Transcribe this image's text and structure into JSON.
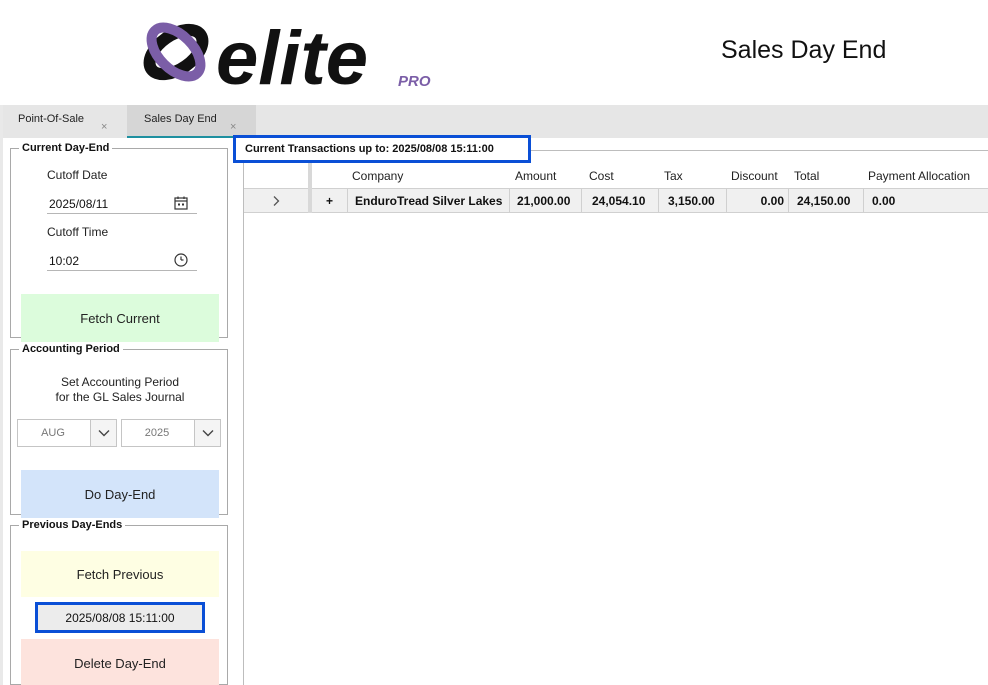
{
  "header": {
    "logo_text": "elite",
    "logo_sub": "PRO",
    "title": "Sales Day End"
  },
  "tabs": [
    {
      "label": "Point-Of-Sale",
      "close": "×",
      "active": false
    },
    {
      "label": "Sales Day End",
      "close": "×",
      "active": true
    }
  ],
  "current_day_end": {
    "legend": "Current Day-End",
    "cutoff_date_label": "Cutoff Date",
    "cutoff_date": "2025/08/11",
    "cutoff_time_label": "Cutoff Time",
    "cutoff_time": "10:02",
    "fetch_button": "Fetch Current",
    "fetch_color": "#dcfcdc"
  },
  "accounting_period": {
    "legend": "Accounting Period",
    "description_line1": "Set Accounting Period",
    "description_line2": "for the GL Sales Journal",
    "month": "AUG",
    "year": "2025",
    "day_end_button": "Do Day-End",
    "day_end_color": "#d3e4fa"
  },
  "previous_day_ends": {
    "legend": "Previous Day-Ends",
    "fetch_button": "Fetch Previous",
    "selected": "2025/08/08 15:11:00",
    "delete_button": "Delete Day-End"
  },
  "transactions": {
    "header": "Current Transactions up to: 2025/08/08 15:11:00",
    "columns": [
      "Company",
      "Amount",
      "Cost",
      "Tax",
      "Discount",
      "Total",
      "Payment Allocation"
    ],
    "rows": [
      {
        "company": "EnduroTread Silver Lakes",
        "amount": "21,000.00",
        "cost": "24,054.10",
        "tax": "3,150.00",
        "discount": "0.00",
        "total": "24,150.00",
        "payment_allocation": "0.00"
      }
    ]
  },
  "colors": {
    "highlight_border": "#0a4fd6",
    "logo_purple": "#7b5ea7",
    "logo_dark": "#111111"
  }
}
